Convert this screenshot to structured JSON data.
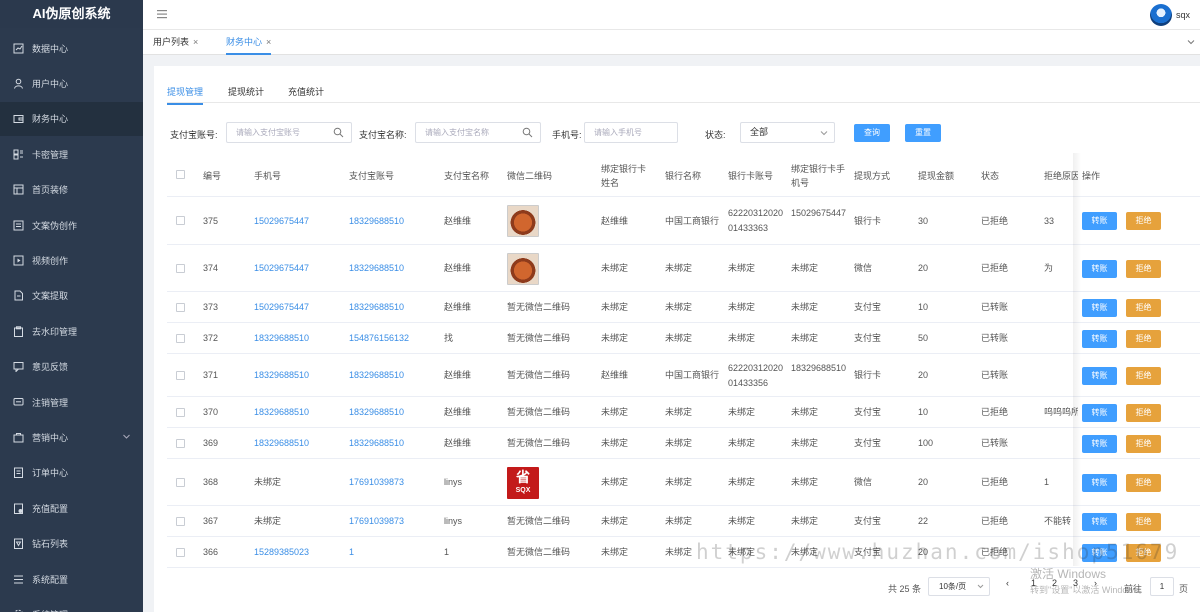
{
  "app": {
    "title": "AI伪原创系统"
  },
  "sidebar": {
    "items": [
      {
        "label": "数据中心",
        "icon": "chart-icon",
        "name": "data-center"
      },
      {
        "label": "用户中心",
        "icon": "user-icon",
        "name": "user-center"
      },
      {
        "label": "财务中心",
        "icon": "wallet-icon",
        "name": "finance-center"
      },
      {
        "label": "卡密管理",
        "icon": "card-icon",
        "name": "card-key"
      },
      {
        "label": "首页装修",
        "icon": "home-icon",
        "name": "home-decor"
      },
      {
        "label": "文案伪创作",
        "icon": "document-icon",
        "name": "copy-create"
      },
      {
        "label": "视频创作",
        "icon": "video-icon",
        "name": "video-create"
      },
      {
        "label": "文案提取",
        "icon": "file-icon",
        "name": "copy-extract"
      },
      {
        "label": "去水印管理",
        "icon": "clipboard-icon",
        "name": "watermark"
      },
      {
        "label": "意见反馈",
        "icon": "message-icon",
        "name": "feedback"
      },
      {
        "label": "注销管理",
        "icon": "chat-icon",
        "name": "cancel-manage"
      },
      {
        "label": "营销中心",
        "icon": "bag-icon",
        "name": "marketing"
      },
      {
        "label": "订单中心",
        "icon": "order-icon",
        "name": "orders"
      },
      {
        "label": "充值配置",
        "icon": "recharge-icon",
        "name": "recharge-config"
      },
      {
        "label": "钻石列表",
        "icon": "diamond-icon",
        "name": "diamond-list"
      },
      {
        "label": "系统配置",
        "icon": "list-icon",
        "name": "system-config"
      },
      {
        "label": "系统管理",
        "icon": "gear-icon",
        "name": "system-manage"
      }
    ]
  },
  "header": {
    "username": "sqx"
  },
  "page_tabs": [
    {
      "label": "用户列表",
      "close": "×"
    },
    {
      "label": "财务中心",
      "close": "×"
    }
  ],
  "inner_tabs": [
    "提现管理",
    "提现统计",
    "充值统计"
  ],
  "filters": {
    "alipay_account": {
      "label": "支付宝账号:",
      "placeholder": "请输入支付宝账号"
    },
    "alipay_name": {
      "label": "支付宝名称:",
      "placeholder": "请输入支付宝名称"
    },
    "phone": {
      "label": "手机号:",
      "placeholder": "请输入手机号"
    },
    "status": {
      "label": "状态:",
      "value": "全部"
    },
    "query_button": "查询",
    "reset_button": "重置"
  },
  "table": {
    "headers": [
      "编号",
      "手机号",
      "支付宝账号",
      "支付宝名称",
      "微信二维码",
      "绑定银行卡姓名",
      "银行名称",
      "银行卡账号",
      "绑定银行卡手机号",
      "提现方式",
      "提现金额",
      "状态",
      "拒绝原因",
      "操作"
    ],
    "approve_label": "转账",
    "reject_label": "拒绝",
    "rows": [
      {
        "id": "375",
        "phone": "15029675447",
        "alipay": "18329688510",
        "alipay_name": "赵维维",
        "qr": "food",
        "card_name": "赵维维",
        "bank": "中国工商银行",
        "card_no": "6222031202001433363",
        "card_phone": "15029675447",
        "method": "银行卡",
        "amount": "30",
        "status": "已拒绝",
        "reason": "33"
      },
      {
        "id": "374",
        "phone": "15029675447",
        "alipay": "18329688510",
        "alipay_name": "赵维维",
        "qr": "food",
        "card_name": "未绑定",
        "bank": "未绑定",
        "card_no": "未绑定",
        "card_phone": "未绑定",
        "method": "微信",
        "amount": "20",
        "status": "已拒绝",
        "reason": "为"
      },
      {
        "id": "373",
        "phone": "15029675447",
        "alipay": "18329688510",
        "alipay_name": "赵维维",
        "qr": "暂无微信二维码",
        "card_name": "未绑定",
        "bank": "未绑定",
        "card_no": "未绑定",
        "card_phone": "未绑定",
        "method": "支付宝",
        "amount": "10",
        "status": "已转账",
        "reason": ""
      },
      {
        "id": "372",
        "phone": "18329688510",
        "alipay": "154876156132",
        "alipay_name": "找",
        "qr": "暂无微信二维码",
        "card_name": "未绑定",
        "bank": "未绑定",
        "card_no": "未绑定",
        "card_phone": "未绑定",
        "method": "支付宝",
        "amount": "50",
        "status": "已转账",
        "reason": ""
      },
      {
        "id": "371",
        "phone": "18329688510",
        "alipay": "18329688510",
        "alipay_name": "赵维维",
        "qr": "暂无微信二维码",
        "card_name": "赵维维",
        "bank": "中国工商银行",
        "card_no": "6222031202001433356",
        "card_phone": "18329688510",
        "method": "银行卡",
        "amount": "20",
        "status": "已转账",
        "reason": ""
      },
      {
        "id": "370",
        "phone": "18329688510",
        "alipay": "18329688510",
        "alipay_name": "赵维维",
        "qr": "暂无微信二维码",
        "card_name": "未绑定",
        "bank": "未绑定",
        "card_no": "未绑定",
        "card_phone": "未绑定",
        "method": "支付宝",
        "amount": "10",
        "status": "已拒绝",
        "reason": "呜呜呜所"
      },
      {
        "id": "369",
        "phone": "18329688510",
        "alipay": "18329688510",
        "alipay_name": "赵维维",
        "qr": "暂无微信二维码",
        "card_name": "未绑定",
        "bank": "未绑定",
        "card_no": "未绑定",
        "card_phone": "未绑定",
        "method": "支付宝",
        "amount": "100",
        "status": "已转账",
        "reason": ""
      },
      {
        "id": "368",
        "phone": "未绑定",
        "alipay": "17691039873",
        "alipay_name": "linys",
        "qr": "red",
        "card_name": "未绑定",
        "bank": "未绑定",
        "card_no": "未绑定",
        "card_phone": "未绑定",
        "method": "微信",
        "amount": "20",
        "status": "已拒绝",
        "reason": "1"
      },
      {
        "id": "367",
        "phone": "未绑定",
        "alipay": "17691039873",
        "alipay_name": "linys",
        "qr": "暂无微信二维码",
        "card_name": "未绑定",
        "bank": "未绑定",
        "card_no": "未绑定",
        "card_phone": "未绑定",
        "method": "支付宝",
        "amount": "22",
        "status": "已拒绝",
        "reason": "不能转"
      },
      {
        "id": "366",
        "phone": "15289385023",
        "alipay": "1",
        "alipay_name": "1",
        "qr": "暂无微信二维码",
        "card_name": "未绑定",
        "bank": "未绑定",
        "card_no": "未绑定",
        "card_phone": "未绑定",
        "method": "支付宝",
        "amount": "20",
        "status": "已拒绝",
        "reason": ""
      }
    ]
  },
  "pagination": {
    "total": "共 25 条",
    "page_size": "10条/页",
    "prev": "‹",
    "pages": [
      "1",
      "2",
      "3"
    ],
    "next": "›",
    "goto_label": "前往",
    "goto_value": "1",
    "page_unit": "页"
  },
  "red_qr": {
    "glyph": "省",
    "caption": "SQX"
  },
  "watermark": {
    "url": "https://www.huzhan.com/ishop51679",
    "windows": "激活 Windows",
    "windows_sub": "转到\"设置\"以激活 Windows。"
  },
  "colors": {
    "sidebar": "#2c3a4e",
    "accent": "#3a8ee6",
    "approve": "#409eff",
    "reject": "#e6a23c"
  }
}
